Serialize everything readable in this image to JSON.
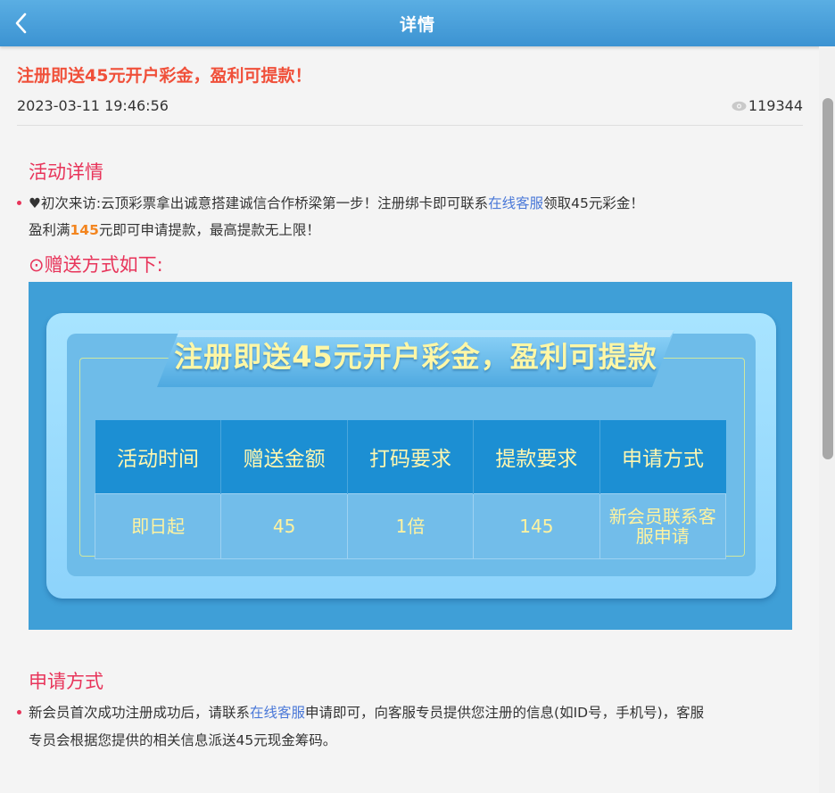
{
  "header": {
    "title": "详情",
    "back_icon": "chevron-left-icon"
  },
  "article": {
    "title": "注册即送45元开户彩金，盈利可提款！",
    "date": "2023-03-11 19:46:56",
    "views": "119344",
    "views_icon": "eye-icon"
  },
  "activity": {
    "heading": "活动详情",
    "line1_heart": "♥",
    "line1_pre": "初次来访:云顶彩票拿出诚意搭建诚信合作桥梁第一步！注册绑卡即可联系",
    "line1_link": "在线客服",
    "line1_post": "领取45元彩金！",
    "line2_pre": "盈利满",
    "line2_highlight": "145",
    "line2_post": "元即可申请提款，最高提款无上限！",
    "gift_heading": "⊙赠送方式如下:"
  },
  "banner": {
    "ribbon_text": "注册即送45元开户彩金，盈利可提款",
    "table": {
      "headers": [
        "活动时间",
        "赠送金额",
        "打码要求",
        "提款要求",
        "申请方式"
      ],
      "row": [
        "即日起",
        "45",
        "1倍",
        "145",
        "新会员联系客服申请"
      ]
    }
  },
  "apply": {
    "heading": "申请方式",
    "line1_pre": "新会员首次成功注册成功后，请联系",
    "line1_link": "在线客服",
    "line1_post": "申请即可，向客服专员提供您注册的信息(如ID号，手机号)，客服",
    "line2": "专员会根据您提供的相关信息派送45元现金筹码。"
  },
  "colors": {
    "header_bg": "#4aa3dd",
    "title_red": "#f0503a",
    "section_pink": "#e8345a",
    "link_blue": "#4a78d8",
    "highlight_orange": "#f3851f",
    "banner_bg": "#3f9fd7",
    "table_text_yellow": "#fff3a0"
  }
}
